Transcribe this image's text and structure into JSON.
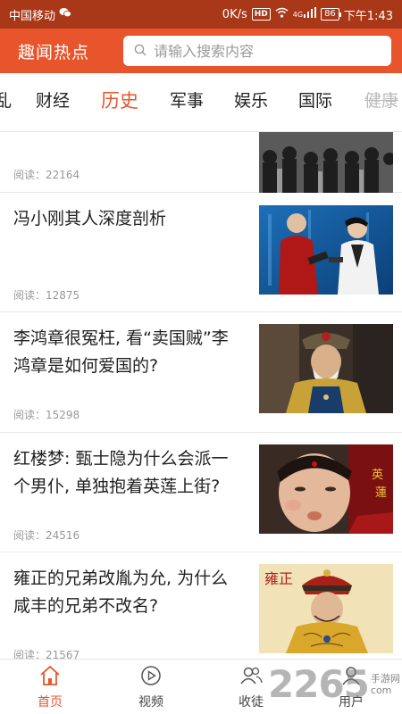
{
  "status_bar": {
    "carrier": "中国移动",
    "speed": "0K/s",
    "hd": "HD",
    "network": "4G",
    "battery": "86",
    "time": "下午1:43"
  },
  "header": {
    "title": "趣闻热点",
    "search_placeholder": "请输入搜索内容"
  },
  "tabs": [
    {
      "label": "乱"
    },
    {
      "label": "财经"
    },
    {
      "label": "历史",
      "active": true
    },
    {
      "label": "军事"
    },
    {
      "label": "娱乐"
    },
    {
      "label": "国际"
    },
    {
      "label": "健康"
    }
  ],
  "articles": [
    {
      "title": "",
      "reads_label": "阅读",
      "reads": "阅读：22164",
      "thumb": "old-photo-crowd-icon"
    },
    {
      "title": "冯小刚其人深度剖析",
      "reads": "阅读：12875",
      "thumb": "press-event-photo"
    },
    {
      "title": "李鸿章很冤枉, 看“卖国贼”李鸿章是如何爱国的?",
      "reads": "阅读：15298",
      "thumb": "qing-official-photo"
    },
    {
      "title": "红楼梦: 甄士隐为什么会派一个男仆, 单独抱着英莲上街?",
      "reads": "阅读：24516",
      "thumb": "child-drama-still",
      "thumb_caption": "英 莲"
    },
    {
      "title": "雍正的兄弟改胤为允, 为什么咸丰的兄弟不改名?",
      "reads": "阅读：21567",
      "thumb": "emperor-drama-still",
      "thumb_caption": "雍正"
    }
  ],
  "bottom_nav": [
    {
      "label": "首页",
      "icon": "home-icon",
      "active": true
    },
    {
      "label": "视频",
      "icon": "play-circle-icon"
    },
    {
      "label": "收徒",
      "icon": "users-icon"
    },
    {
      "label": "用户",
      "icon": "user-icon"
    }
  ],
  "watermark": {
    "big": "2265",
    "small_1": "手游网",
    "small_2": "com"
  },
  "colors": {
    "primary": "#e8542b",
    "status_bar": "#a83818",
    "muted_text": "#999999"
  }
}
